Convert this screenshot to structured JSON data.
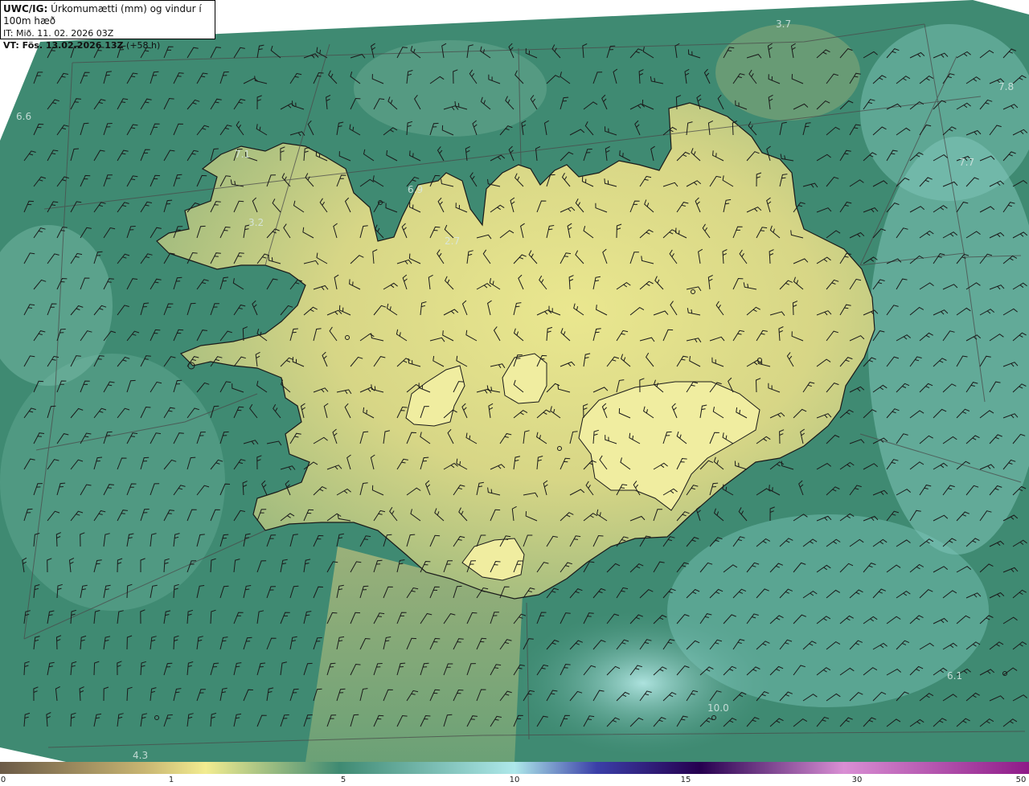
{
  "header": {
    "model_label": "UWC/IG:",
    "title": "Úrkomumætti (mm) og vindur í 100m hæð",
    "issue_time": "IT: Mið. 11. 02. 2026 03Z",
    "valid_label": "VT: Fös. 13.02.2026 13Z",
    "valid_offset": "(+58 h)"
  },
  "map": {
    "region": "Iceland",
    "icons": [
      "wind-barb-icon",
      "coastline-outline"
    ],
    "value_labels": [
      "3.7",
      "7.8",
      "6.6",
      "7.1",
      "6.9",
      "3.2",
      "2.7",
      "7.7",
      "6.1",
      "10.0",
      "4.3"
    ]
  },
  "colorbar": {
    "ticks": [
      "0",
      "1",
      "5",
      "10",
      "15",
      "30",
      "50"
    ],
    "colors": [
      "#6b5a47",
      "#c8b572",
      "#f2ec90",
      "#3f8a72",
      "#aee8ea",
      "#3b3fa8",
      "#26004f",
      "#d98fd4",
      "#8e1a88"
    ]
  },
  "colors": {
    "land_yellow": "#e4e28c",
    "ocean_teal": "#3f8a72",
    "ocean_light": "#8fd0c8",
    "coastline": "#1a1a1a"
  }
}
